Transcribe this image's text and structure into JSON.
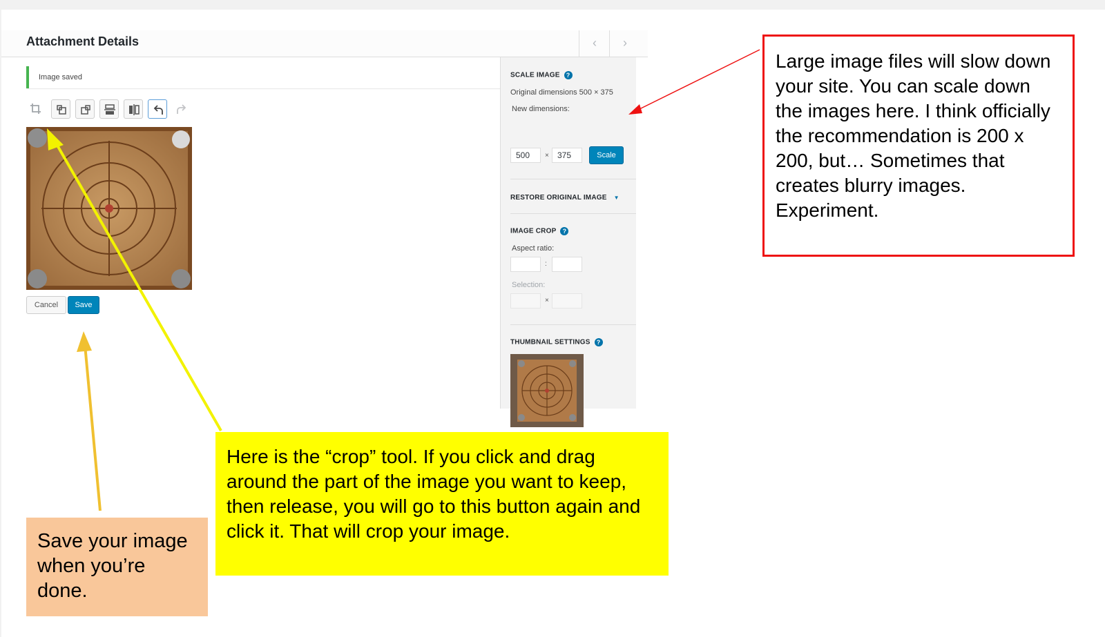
{
  "header": {
    "title": "Attachment Details",
    "prev_glyph": "‹",
    "next_glyph": "›"
  },
  "notice": {
    "text": "Image saved"
  },
  "toolbar": {
    "icons": [
      "crop-icon",
      "rotate-left-icon",
      "rotate-right-icon",
      "flip-vertical-icon",
      "flip-horizontal-icon",
      "undo-icon",
      "redo-icon"
    ]
  },
  "editor": {
    "cancel_label": "Cancel",
    "save_label": "Save"
  },
  "sidebar": {
    "scale": {
      "heading": "SCALE IMAGE",
      "original": "Original dimensions 500 × 375",
      "new_label": "New dimensions:",
      "width": "500",
      "height": "375",
      "times": "×",
      "button": "Scale"
    },
    "restore": {
      "heading": "RESTORE ORIGINAL IMAGE",
      "arrow": "▼"
    },
    "crop": {
      "heading": "IMAGE CROP",
      "aspect_label": "Aspect ratio:",
      "aspect_sep": ":",
      "selection_label": "Selection:",
      "selection_sep": "×"
    },
    "thumbnail": {
      "heading": "THUMBNAIL SETTINGS"
    },
    "help_glyph": "?"
  },
  "annotations": {
    "red": "Large image files will slow down your site. You can scale down the images here. I think officially the recommendation is 200 x 200, but… Sometimes that creates blurry images. Experiment.",
    "yellow": "Here is the “crop” tool. If you click and drag around the part of the image you want to keep, then release, you will go to this button again and click it. That will crop your image.",
    "orange": "Save your image when you’re done."
  },
  "colors": {
    "primary_button": "#0085ba",
    "notice_success": "#46b450",
    "annotation_red": "#ee1111",
    "annotation_yellow": "#ffff00",
    "annotation_orange": "#f9c79a",
    "arrow_yellow": "#f2f200",
    "arrow_orange": "#f0c030"
  }
}
